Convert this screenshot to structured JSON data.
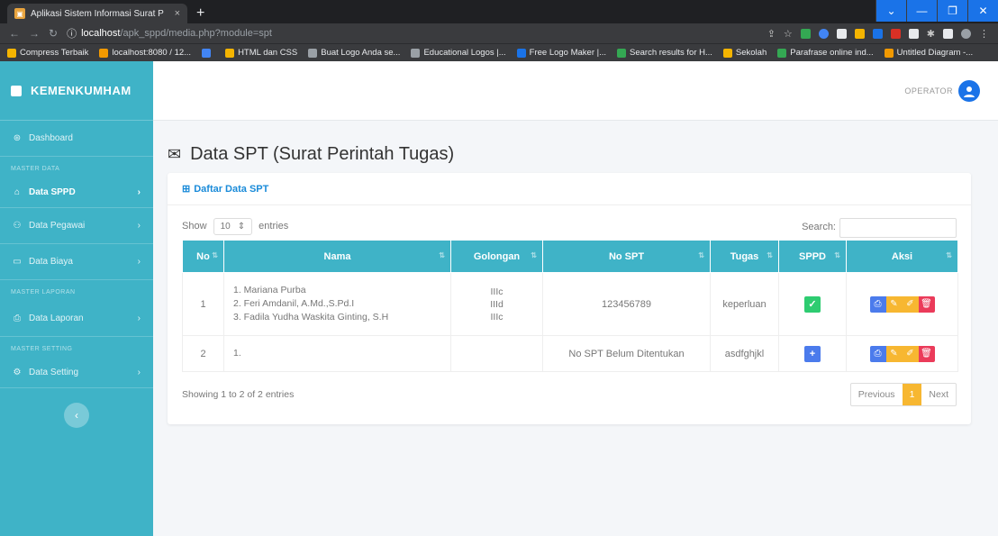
{
  "browser": {
    "tab_title": "Aplikasi Sistem Informasi Surat P",
    "tab_close": "×",
    "new_tab": "+",
    "url_host": "localhost",
    "url_path": "/apk_sppd/media.php?module=spt",
    "bookmarks": [
      {
        "label": "Compress Terbaik",
        "color": "#f4b400"
      },
      {
        "label": "localhost:8080 / 12...",
        "color": "#f29900"
      },
      {
        "label": "",
        "color": "#4285f4"
      },
      {
        "label": "HTML dan CSS",
        "color": "#f4b400"
      },
      {
        "label": "Buat Logo Anda se...",
        "color": "#9aa0a6"
      },
      {
        "label": "Educational Logos |...",
        "color": "#9aa0a6"
      },
      {
        "label": "Free Logo Maker |...",
        "color": "#1a73e8"
      },
      {
        "label": "Search results for H...",
        "color": "#34a853"
      },
      {
        "label": "Sekolah",
        "color": "#f4b400"
      },
      {
        "label": "Parafrase online ind...",
        "color": "#34a853"
      },
      {
        "label": "Untitled Diagram -...",
        "color": "#f29900"
      }
    ]
  },
  "sidebar": {
    "brand": "KEMENKUMHAM",
    "dashboard": "Dashboard",
    "section_master_data": "MASTER DATA",
    "data_sppd": "Data SPPD",
    "data_pegawai": "Data Pegawai",
    "data_biaya": "Data Biaya",
    "section_master_laporan": "MASTER LAPORAN",
    "data_laporan": "Data Laporan",
    "section_master_setting": "MASTER SETTING",
    "data_setting": "Data Setting"
  },
  "topnav": {
    "user_role": "OPERATOR"
  },
  "page": {
    "title": "Data SPT (Surat Perintah Tugas)"
  },
  "card": {
    "title": "Daftar Data SPT",
    "show_label": "Show",
    "entries_value": "10",
    "entries_label": "entries",
    "search_label": "Search:",
    "search_placeholder": ""
  },
  "table": {
    "headers": [
      "No",
      "Nama",
      "Golongan",
      "No SPT",
      "Tugas",
      "SPPD",
      "Aksi"
    ],
    "rows": [
      {
        "no": "1",
        "nama": [
          "1. Mariana Purba",
          "2. Feri Amdanil, A.Md.,S.Pd.I",
          "3. Fadila Yudha Waskita Ginting, S.H"
        ],
        "golongan": [
          "IIIc",
          "IIId",
          "IIIc"
        ],
        "no_spt": "123456789",
        "tugas": "keperluan",
        "sppd": "check"
      },
      {
        "no": "2",
        "nama": [
          "1."
        ],
        "golongan": [],
        "no_spt": "No SPT Belum Ditentukan",
        "tugas": "asdfghjkl",
        "sppd": "add"
      }
    ]
  },
  "footer": {
    "info": "Showing 1 to 2 of 2 entries",
    "previous": "Previous",
    "page": "1",
    "next": "Next"
  },
  "colors": {
    "sidebar": "#3fb3c7",
    "primary": "#4b7bec",
    "warning": "#f7b731",
    "danger": "#eb3b5a",
    "success": "#2ecc71"
  }
}
